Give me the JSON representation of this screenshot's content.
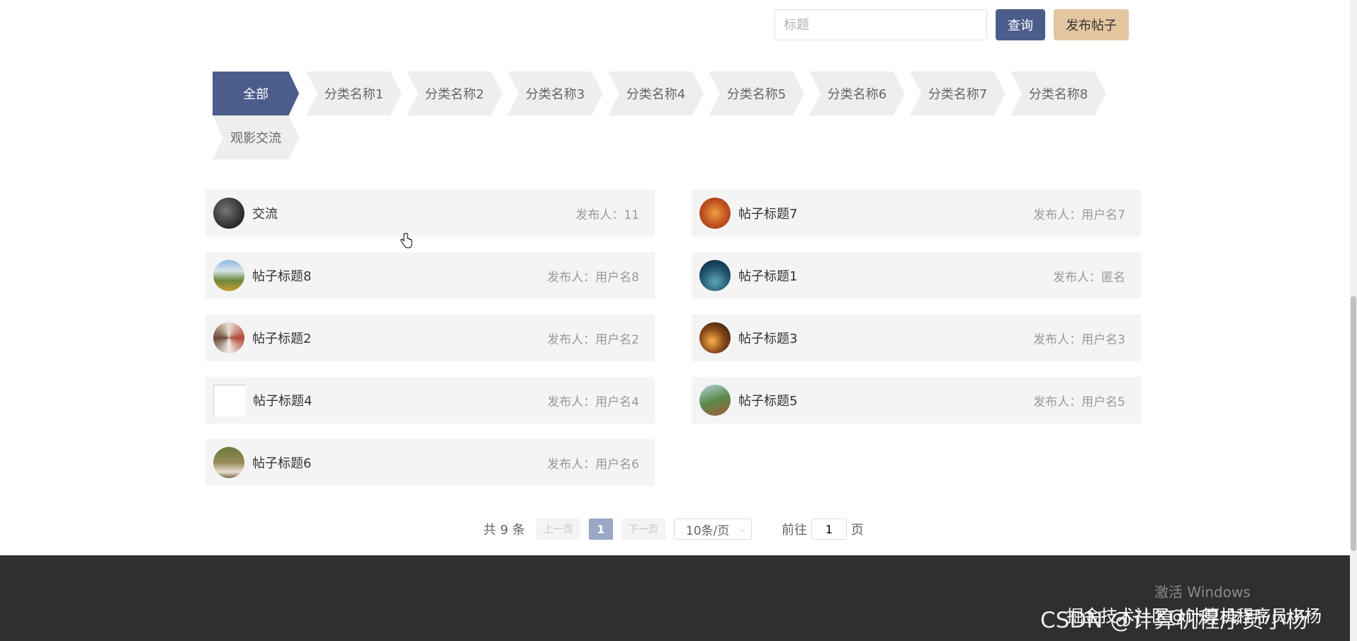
{
  "search": {
    "placeholder": "标题",
    "query_label": "查询",
    "post_label": "发布帖子"
  },
  "categories": [
    "全部",
    "分类名称1",
    "分类名称2",
    "分类名称3",
    "分类名称4",
    "分类名称5",
    "分类名称6",
    "分类名称7",
    "分类名称8",
    "观影交流"
  ],
  "active_category": "全部",
  "posts": [
    {
      "title": "交流",
      "author": "发布人：11"
    },
    {
      "title": "帖子标题7",
      "author": "发布人：用户名7"
    },
    {
      "title": "帖子标题8",
      "author": "发布人：用户名8"
    },
    {
      "title": "帖子标题1",
      "author": "发布人：匿名"
    },
    {
      "title": "帖子标题2",
      "author": "发布人：用户名2"
    },
    {
      "title": "帖子标题3",
      "author": "发布人：用户名3"
    },
    {
      "title": "帖子标题4",
      "author": "发布人：用户名4"
    },
    {
      "title": "帖子标题5",
      "author": "发布人：用户名5"
    },
    {
      "title": "帖子标题6",
      "author": "发布人：用户名6"
    }
  ],
  "pagination": {
    "total": "共 9 条",
    "prev": "上一页",
    "current": "1",
    "next": "下一页",
    "page_size": "10条/页",
    "goto_label": "前往",
    "goto_value": "1",
    "goto_suffix": "页"
  },
  "overlay": {
    "activate_windows": "激活 Windows",
    "watermark_csdn": "CSDN @计算机程序员小杨",
    "watermark_juejin": "掘金技术社区@计算机程序员小杨"
  },
  "colors": {
    "primary": "#4c5d8c",
    "accent": "#e3c59f",
    "footer": "#2f2f2f"
  }
}
